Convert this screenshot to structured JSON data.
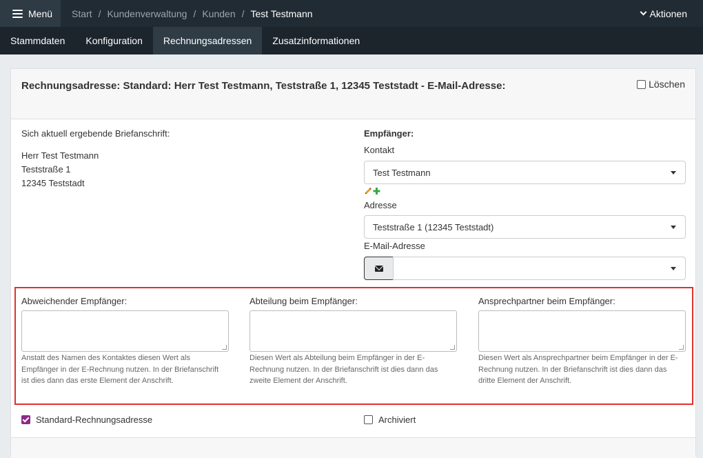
{
  "header": {
    "menu_label": "Menü",
    "breadcrumb": [
      "Start",
      "Kundenverwaltung",
      "Kunden",
      "Test Testmann"
    ],
    "actions_label": "Aktionen"
  },
  "tabs": [
    "Stammdaten",
    "Konfiguration",
    "Rechnungsadressen",
    "Zusatzinformationen"
  ],
  "active_tab": "Rechnungsadressen",
  "card": {
    "title": "Rechnungsadresse: Standard: Herr Test Testmann, Teststraße 1, 12345 Teststadt - E-Mail-Adresse:",
    "delete_label": "Löschen"
  },
  "letterhead": {
    "label": "Sich aktuell ergebende Briefanschrift:",
    "lines": [
      "Herr Test Testmann",
      "Teststraße 1",
      "12345 Teststadt"
    ]
  },
  "recipient": {
    "heading": "Empfänger:",
    "contact_label": "Kontakt",
    "contact_value": "Test Testmann",
    "address_label": "Adresse",
    "address_value": "Teststraße 1 (12345 Teststadt)",
    "email_label": "E-Mail-Adresse",
    "email_value": ""
  },
  "extra_fields": [
    {
      "label": "Abweichender Empfänger:",
      "help": "Anstatt des Namen des Kontaktes diesen Wert als Empfänger in der E-Rechnung nutzen. In der Briefanschrift ist dies dann das erste Element der Anschrift."
    },
    {
      "label": "Abteilung beim Empfänger:",
      "help": "Diesen Wert als Abteilung beim Empfänger in der E-Rechnung nutzen. In der Briefanschrift ist dies dann das zweite Element der Anschrift."
    },
    {
      "label": "Ansprechpartner beim Empfänger:",
      "help": "Diesen Wert als Ansprechpartner beim Empfänger in der E-Rechnung nutzen. In der Briefanschrift ist dies dann das dritte Element der Anschrift."
    }
  ],
  "checkboxes": {
    "standard_label": "Standard-Rechnungsadresse",
    "standard_checked": true,
    "archived_label": "Archiviert",
    "archived_checked": false
  },
  "colors": {
    "topbar": "#212b33",
    "tabbar": "#1c252c",
    "active_tab": "#2f3c46",
    "highlight": "#e0312b",
    "checkbox_checked": "#8e2a8b",
    "add_icon": "#3aa843",
    "pencil_icon": "#d9a520"
  }
}
